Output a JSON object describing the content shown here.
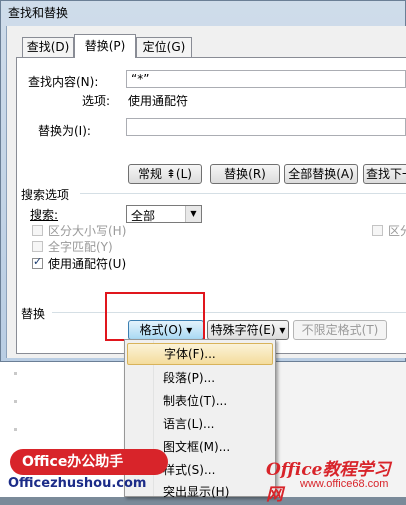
{
  "window": {
    "title": "查找和替换"
  },
  "tabs": [
    {
      "label": "查找(D)",
      "active": false
    },
    {
      "label": "替换(P)",
      "active": true
    },
    {
      "label": "定位(G)",
      "active": false
    }
  ],
  "find": {
    "label": "查找内容(N):",
    "value": "“*”",
    "options_label": "选项:",
    "options_value": "使用通配符"
  },
  "replace": {
    "label": "替换为(I):",
    "value": ""
  },
  "buttons": {
    "less": "常规 ⇞(L)",
    "replace": "替换(R)",
    "replace_all": "全部替换(A)",
    "find_next": "查找下一处(F)"
  },
  "search_options": {
    "section_label": "搜索选项",
    "search_label": "搜索:",
    "search_value": "全部",
    "match_case": "区分大小写(H)",
    "whole_word": "全字匹配(Y)",
    "use_wildcards": "使用通配符(U)",
    "use_wildcards_checked": true,
    "right_clipped": "区分"
  },
  "replace_section": {
    "label": "替换",
    "format_button": "格式(O) ▾",
    "special_button": "特殊字符(E) ▾",
    "no_format_button": "不限定格式(T)"
  },
  "format_menu": {
    "items": [
      "字体(F)...",
      "段落(P)...",
      "制表位(T)...",
      "语言(L)...",
      "图文框(M)...",
      "样式(S)...",
      "突出显示(H)"
    ],
    "highlighted_index": 0
  },
  "watermarks": {
    "left_brand": "Office办公助手",
    "left_url": "Officezhushou.com",
    "right_brand": "Office教程学习网",
    "right_url": "www.office68.com"
  }
}
